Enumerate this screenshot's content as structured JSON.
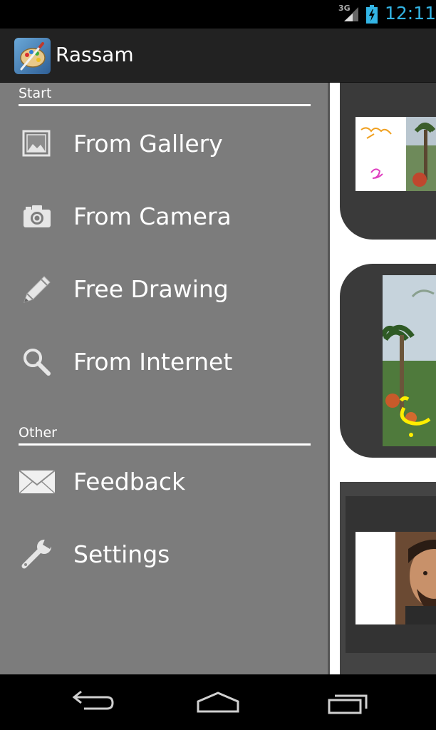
{
  "status_bar": {
    "network": "3G",
    "time": "12:11",
    "clock_color": "#33b5e5",
    "icons": [
      "signal-icon",
      "battery-charging-icon"
    ]
  },
  "action_bar": {
    "title": "Rassam",
    "icon": "palette-app-icon"
  },
  "drawer": {
    "sections": [
      {
        "header": "Start",
        "items": [
          {
            "label": "From Gallery",
            "icon": "gallery-icon"
          },
          {
            "label": "From Camera",
            "icon": "camera-icon"
          },
          {
            "label": "Free Drawing",
            "icon": "pencil-icon"
          },
          {
            "label": "From Internet",
            "icon": "search-icon"
          }
        ]
      },
      {
        "header": "Other",
        "items": [
          {
            "label": "Feedback",
            "icon": "envelope-icon"
          },
          {
            "label": "Settings",
            "icon": "wrench-icon"
          }
        ]
      }
    ]
  },
  "nav_bar": {
    "buttons": [
      "back-icon",
      "home-icon",
      "recent-apps-icon"
    ]
  }
}
